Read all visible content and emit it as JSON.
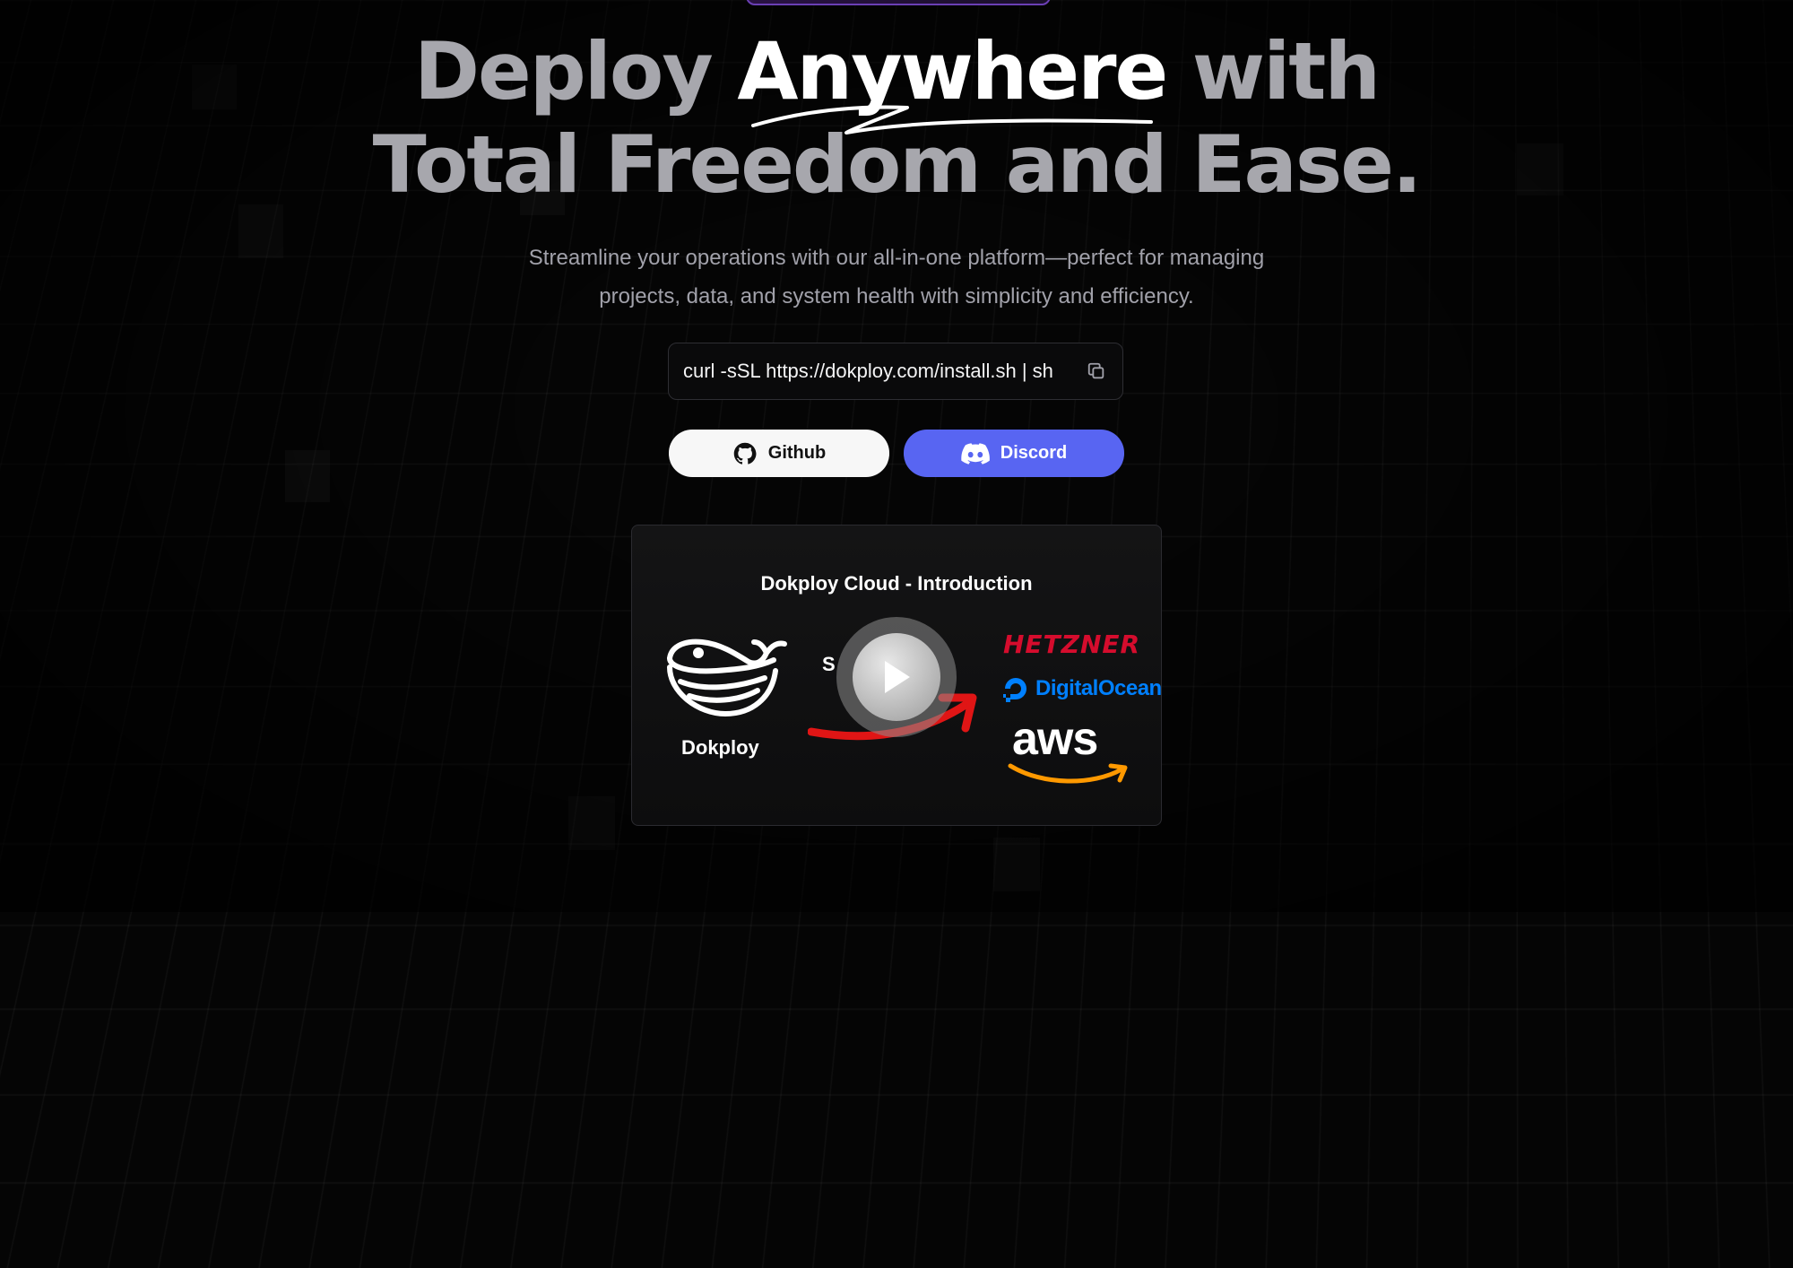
{
  "hero": {
    "title_prefix": "Deploy ",
    "title_highlight": "Anywhere",
    "title_suffix": " with",
    "title_line2": "Total Freedom and Ease."
  },
  "subtitle": {
    "line1": "Streamline your operations with our all-in-one platform—perfect for managing",
    "line2": "projects, data, and system health with simplicity and efficiency."
  },
  "install": {
    "command": "curl -sSL https://dokploy.com/install.sh | sh",
    "copy_icon": "copy-icon"
  },
  "buttons": {
    "github_label": "Github",
    "github_icon": "github-icon",
    "discord_label": "Discord",
    "discord_icon": "discord-icon"
  },
  "video": {
    "title": "Dokploy Cloud - Introduction",
    "dokploy_label": "Dokploy",
    "server_label": "S",
    "server_label_end": ")",
    "providers": {
      "hetzner": "HETZNER",
      "digitalocean": "DigitalOcean",
      "aws": "aws"
    },
    "play_icon": "play-icon"
  },
  "colors": {
    "background": "#050505",
    "discord": "#5865f2",
    "hetzner": "#d50c2d",
    "digitalocean": "#0080ff",
    "aws_smile": "#ff9900",
    "arrow": "#e01515"
  }
}
